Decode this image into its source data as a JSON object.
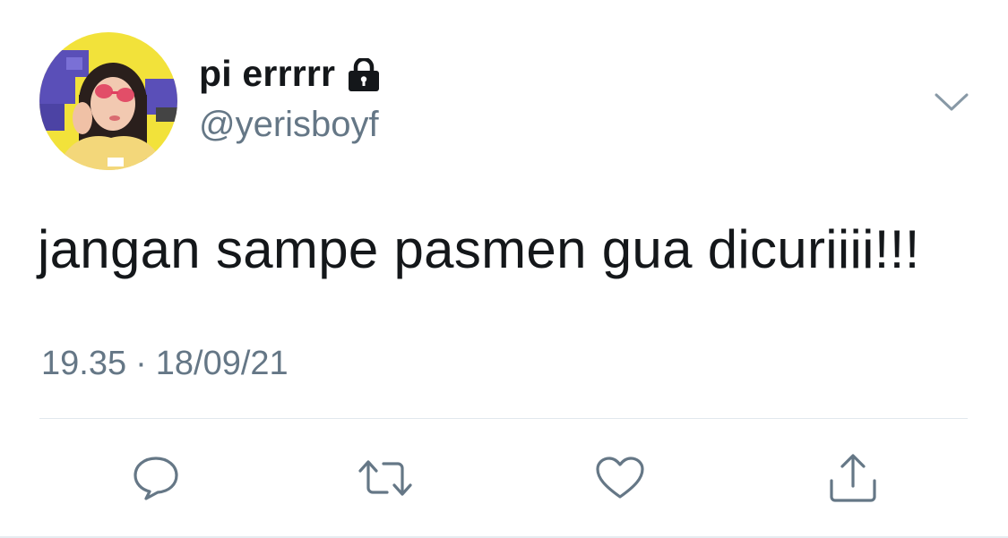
{
  "tweet": {
    "author": {
      "display_name": "pi errrrr",
      "handle": "@yerisboyf",
      "protected_icon": "lock-icon",
      "avatar": "profile-photo"
    },
    "text": "jangan sampe pasmen gua dicuriiii!!!",
    "time": "19.35",
    "separator": "·",
    "date": "18/09/21"
  },
  "actions": [
    {
      "name": "reply",
      "icon": "comment-icon"
    },
    {
      "name": "retweet",
      "icon": "retweet-icon"
    },
    {
      "name": "like",
      "icon": "heart-icon"
    },
    {
      "name": "share",
      "icon": "share-icon"
    }
  ],
  "menu": {
    "icon": "chevron-down-icon"
  },
  "colors": {
    "text_primary": "#14171a",
    "text_secondary": "#657786",
    "icon": "#657786",
    "divider": "#e1e8ed",
    "background": "#ffffff"
  }
}
